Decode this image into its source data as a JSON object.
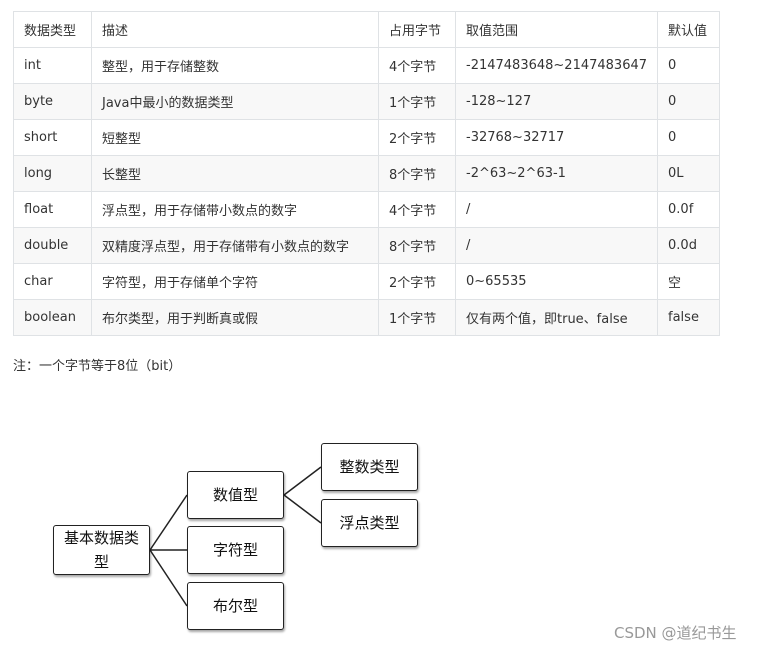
{
  "table": {
    "headers": [
      "数据类型",
      "描述",
      "占用字节",
      "取值范围",
      "默认值"
    ],
    "rows": [
      [
        "int",
        "整型，用于存储整数",
        "4个字节",
        "-2147483648~2147483647",
        "0"
      ],
      [
        "byte",
        "Java中最小的数据类型",
        "1个字节",
        "-128~127",
        "0"
      ],
      [
        "short",
        "短整型",
        "2个字节",
        "-32768~32717",
        "0"
      ],
      [
        "long",
        "长整型",
        "8个字节",
        "-2^63~2^63-1",
        "0L"
      ],
      [
        "float",
        "浮点型，用于存储带小数点的数字",
        "4个字节",
        "/",
        "0.0f"
      ],
      [
        "double",
        "双精度浮点型，用于存储带有小数点的数字",
        "8个字节",
        "/",
        "0.0d"
      ],
      [
        "char",
        "字符型，用于存储单个字符",
        "2个字节",
        "0~65535",
        "空"
      ],
      [
        "boolean",
        "布尔类型，用于判断真或假",
        "1个字节",
        "仅有两个值，即true、false",
        "false"
      ]
    ]
  },
  "note": "注：一个字节等于8位（bit）",
  "diagram": {
    "root": "基本数据类型",
    "numeric": "数值型",
    "char": "字符型",
    "bool": "布尔型",
    "integer": "整数类型",
    "float": "浮点类型"
  },
  "watermark": "CSDN @道纪书生"
}
